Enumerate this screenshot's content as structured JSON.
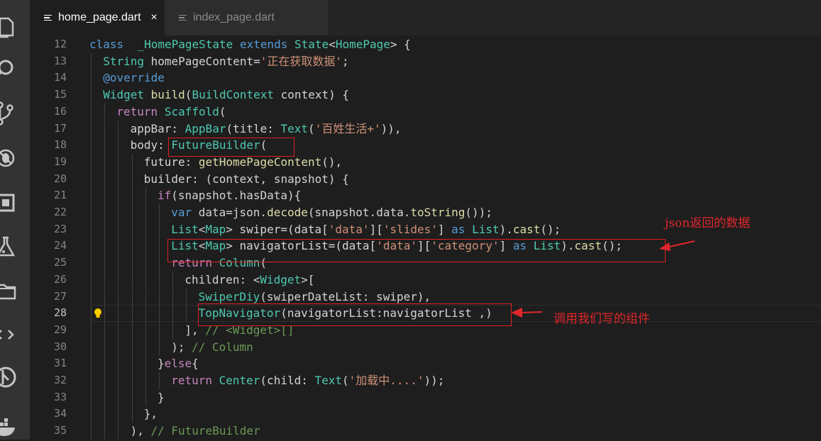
{
  "tabs": [
    {
      "label": "home_page.dart",
      "active": true,
      "close": "×"
    },
    {
      "label": "index_page.dart",
      "active": false
    }
  ],
  "activity_icons": [
    "explorer-icon",
    "search-icon",
    "source-control-icon",
    "debug-icon",
    "extensions-icon",
    "flask-icon",
    "folder-icon",
    "code-icon",
    "git-icon",
    "docker-icon"
  ],
  "colors": {
    "annotation": "#e0262b",
    "keyword": "#569cd6",
    "type": "#4ec9b0",
    "function": "#dcdcaa",
    "string": "#ce9178",
    "comment": "#6a9955"
  },
  "current_line": 28,
  "code": [
    {
      "n": "12",
      "indent": 0,
      "tokens": [
        [
          "kw",
          "class"
        ],
        [
          "",
          "  "
        ],
        [
          "ty",
          "_HomePageState"
        ],
        [
          "",
          " "
        ],
        [
          "kw",
          "extends"
        ],
        [
          "",
          " "
        ],
        [
          "ty",
          "State"
        ],
        [
          "",
          "<"
        ],
        [
          "ty",
          "HomePage"
        ],
        [
          "",
          "> {"
        ]
      ]
    },
    {
      "n": "13",
      "indent": 1,
      "tokens": [
        [
          "ty",
          "String"
        ],
        [
          "",
          " homePageContent="
        ],
        [
          "st",
          "'正在获取数据'"
        ],
        [
          "",
          ";"
        ]
      ]
    },
    {
      "n": "14",
      "indent": 1,
      "tokens": [
        [
          "kw",
          "@override"
        ]
      ]
    },
    {
      "n": "15",
      "indent": 1,
      "tokens": [
        [
          "ty",
          "Widget"
        ],
        [
          "",
          " "
        ],
        [
          "fn",
          "build"
        ],
        [
          "",
          "("
        ],
        [
          "ty",
          "BuildContext"
        ],
        [
          "",
          " context) {"
        ]
      ]
    },
    {
      "n": "16",
      "indent": 2,
      "tokens": [
        [
          "ctl",
          "return"
        ],
        [
          "",
          " "
        ],
        [
          "ty",
          "Scaffold"
        ],
        [
          "",
          "("
        ]
      ]
    },
    {
      "n": "17",
      "indent": 3,
      "tokens": [
        [
          "",
          "appBar: "
        ],
        [
          "ty",
          "AppBar"
        ],
        [
          "",
          "(title: "
        ],
        [
          "ty",
          "Text"
        ],
        [
          "",
          "("
        ],
        [
          "st",
          "'百姓生活+'"
        ],
        [
          "",
          ")),"
        ]
      ]
    },
    {
      "n": "18",
      "indent": 3,
      "tokens": [
        [
          "",
          "body: "
        ],
        [
          "ty",
          "FutureBuilder"
        ],
        [
          "",
          "("
        ]
      ]
    },
    {
      "n": "19",
      "indent": 4,
      "tokens": [
        [
          "",
          "future: "
        ],
        [
          "fn",
          "getHomePageContent"
        ],
        [
          "",
          "(),"
        ]
      ]
    },
    {
      "n": "20",
      "indent": 4,
      "tokens": [
        [
          "",
          "builder: (context, snapshot) {"
        ]
      ]
    },
    {
      "n": "21",
      "indent": 5,
      "tokens": [
        [
          "ctl",
          "if"
        ],
        [
          "",
          "(snapshot.hasData){"
        ]
      ]
    },
    {
      "n": "22",
      "indent": 6,
      "tokens": [
        [
          "kw",
          "var"
        ],
        [
          "",
          " data=json."
        ],
        [
          "fn",
          "decode"
        ],
        [
          "",
          "(snapshot.data."
        ],
        [
          "fn",
          "toString"
        ],
        [
          "",
          "());"
        ]
      ]
    },
    {
      "n": "23",
      "indent": 6,
      "tokens": [
        [
          "ty",
          "List"
        ],
        [
          "",
          "<"
        ],
        [
          "ty",
          "Map"
        ],
        [
          "",
          "> swiper=(data["
        ],
        [
          "st",
          "'data'"
        ],
        [
          "",
          "]["
        ],
        [
          "st",
          "'slides'"
        ],
        [
          "",
          "] "
        ],
        [
          "kw",
          "as"
        ],
        [
          "",
          " "
        ],
        [
          "ty",
          "List"
        ],
        [
          "",
          ")."
        ],
        [
          "fn",
          "cast"
        ],
        [
          "",
          "();"
        ]
      ]
    },
    {
      "n": "24",
      "indent": 6,
      "tokens": [
        [
          "ty",
          "List"
        ],
        [
          "",
          "<"
        ],
        [
          "ty",
          "Map"
        ],
        [
          "",
          "> navigatorList=(data["
        ],
        [
          "st",
          "'data'"
        ],
        [
          "",
          "]["
        ],
        [
          "st",
          "'category'"
        ],
        [
          "",
          "] "
        ],
        [
          "kw",
          "as"
        ],
        [
          "",
          " "
        ],
        [
          "ty",
          "List"
        ],
        [
          "",
          ")."
        ],
        [
          "fn",
          "cast"
        ],
        [
          "",
          "();"
        ]
      ]
    },
    {
      "n": "25",
      "indent": 6,
      "tokens": [
        [
          "ctl",
          "return"
        ],
        [
          "",
          " "
        ],
        [
          "ty",
          "Column"
        ],
        [
          "",
          "("
        ]
      ]
    },
    {
      "n": "26",
      "indent": 7,
      "tokens": [
        [
          "",
          "children: <"
        ],
        [
          "ty",
          "Widget"
        ],
        [
          "",
          ">["
        ]
      ]
    },
    {
      "n": "27",
      "indent": 8,
      "tokens": [
        [
          "ty",
          "SwiperDiy"
        ],
        [
          "",
          "(swiperDateList: swiper),"
        ]
      ]
    },
    {
      "n": "28",
      "indent": 8,
      "tokens": [
        [
          "ty",
          "TopNavigator"
        ],
        [
          "",
          "(navigatorList:navigatorList ,)"
        ]
      ]
    },
    {
      "n": "29",
      "indent": 7,
      "tokens": [
        [
          "",
          "], "
        ],
        [
          "cm",
          "// <Widget>[]"
        ]
      ]
    },
    {
      "n": "30",
      "indent": 6,
      "tokens": [
        [
          "",
          "); "
        ],
        [
          "cm",
          "// Column"
        ]
      ]
    },
    {
      "n": "31",
      "indent": 5,
      "tokens": [
        [
          "",
          "}"
        ],
        [
          "ctl",
          "else"
        ],
        [
          "",
          "{"
        ]
      ]
    },
    {
      "n": "32",
      "indent": 6,
      "tokens": [
        [
          "ctl",
          "return"
        ],
        [
          "",
          " "
        ],
        [
          "ty",
          "Center"
        ],
        [
          "",
          "(child: "
        ],
        [
          "ty",
          "Text"
        ],
        [
          "",
          "("
        ],
        [
          "st",
          "'加载中....'"
        ],
        [
          "",
          "));"
        ]
      ]
    },
    {
      "n": "33",
      "indent": 5,
      "tokens": [
        [
          "",
          "}"
        ]
      ]
    },
    {
      "n": "34",
      "indent": 4,
      "tokens": [
        [
          "",
          "},"
        ]
      ]
    },
    {
      "n": "35",
      "indent": 3,
      "tokens": [
        [
          "",
          "), "
        ],
        [
          "cm",
          "// FutureBuilder"
        ]
      ]
    }
  ],
  "annotations": [
    {
      "text": "json返回的数据"
    },
    {
      "text": "调用我们写的组件"
    }
  ]
}
